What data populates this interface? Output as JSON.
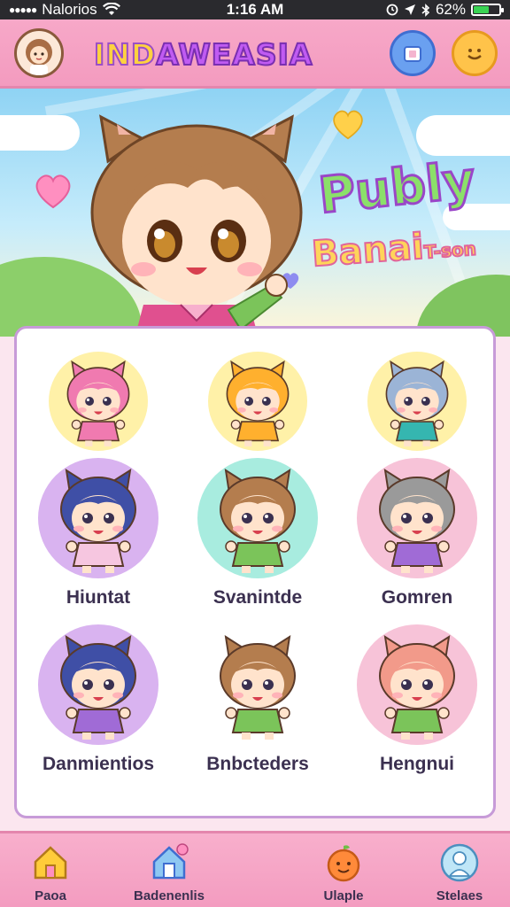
{
  "status_bar": {
    "carrier": "Nalorios",
    "time": "1:16 AM",
    "battery_text": "62%",
    "battery_level": 0.62
  },
  "header": {
    "title_part1": "IND",
    "title_part2": "AWEASIA"
  },
  "banner": {
    "title_line1": "Publy",
    "title_line2": "Banai",
    "title_line2_small": "T-son"
  },
  "grid": {
    "items": [
      {
        "label": "",
        "bg": "#fff1a8",
        "hair": "#f07ab0",
        "outfit": "#f07ab0"
      },
      {
        "label": "",
        "bg": "#fff1a8",
        "hair": "#ffb02e",
        "outfit": "#ffb02e"
      },
      {
        "label": "",
        "bg": "#fff1a8",
        "hair": "#9bb4d6",
        "outfit": "#35b6b0"
      },
      {
        "label": "Hiuntat",
        "bg": "#d9b3f0",
        "hair": "#3f4fa6",
        "outfit": "#f6c6e0"
      },
      {
        "label": "Svanintde",
        "bg": "#a8ecdf",
        "hair": "#b47d4e",
        "outfit": "#7bc45a"
      },
      {
        "label": "Gomren",
        "bg": "#f7c3d8",
        "hair": "#9a9a9a",
        "outfit": "#a06bd6"
      },
      {
        "label": "Danmientios",
        "bg": "#d9b3f0",
        "hair": "#3f4fa6",
        "outfit": "#a06bd6"
      },
      {
        "label": "Bnbcteders",
        "bg": "#ffffff",
        "hair": "#b47d4e",
        "outfit": "#7bc45a"
      },
      {
        "label": "Hengnui",
        "bg": "#f7c3d8",
        "hair": "#f29a8a",
        "outfit": "#7bc45a"
      }
    ]
  },
  "tabs": [
    {
      "label": "Paoa",
      "icon": "home-icon"
    },
    {
      "label": "Badenenlis",
      "icon": "house-badge-icon"
    },
    {
      "label": "Ulaple",
      "icon": "fruit-face-icon"
    },
    {
      "label": "Stelaes",
      "icon": "character-icon"
    }
  ],
  "colors": {
    "header_pink": "#f39bbf",
    "panel_border": "#c79bd8",
    "shop_blue": "#6aa0f0",
    "face_yellow": "#ffc34a"
  }
}
